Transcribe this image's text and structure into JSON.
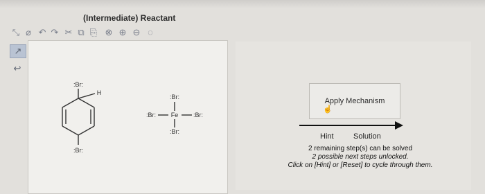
{
  "header": {
    "title": "(Intermediate) Reactant"
  },
  "toolbar": {
    "tools": [
      {
        "name": "select-tool-icon",
        "glyph": "⤡"
      },
      {
        "name": "eraser-icon",
        "glyph": "⌀"
      },
      {
        "name": "undo-icon",
        "glyph": "↶"
      },
      {
        "name": "redo-icon",
        "glyph": "↷"
      },
      {
        "name": "cut-icon",
        "glyph": "✂"
      },
      {
        "name": "copy-icon",
        "glyph": "⧉"
      },
      {
        "name": "paste-icon",
        "glyph": "⎘"
      },
      {
        "name": "zoom-fit-icon",
        "glyph": "⊗"
      },
      {
        "name": "zoom-in-icon",
        "glyph": "⊕"
      },
      {
        "name": "zoom-out-icon",
        "glyph": "⊖"
      },
      {
        "name": "zoom-reset-icon",
        "glyph": "◌"
      }
    ]
  },
  "side_tools": [
    {
      "name": "arrow-push-icon",
      "glyph": "↗"
    },
    {
      "name": "curved-arrow-icon",
      "glyph": "↩"
    }
  ],
  "molecules": {
    "br_atom": ":Br:",
    "h_atom": "H",
    "fe_atom": "Fe"
  },
  "mechanism": {
    "apply_label": "Apply Mechanism",
    "hint_label": "Hint",
    "solution_label": "Solution",
    "status_line1": "2 remaining step(s) can be solved",
    "status_line2": "2 possible next steps unlocked.",
    "status_line3": "Click on [Hint] or [Reset] to cycle through them."
  }
}
